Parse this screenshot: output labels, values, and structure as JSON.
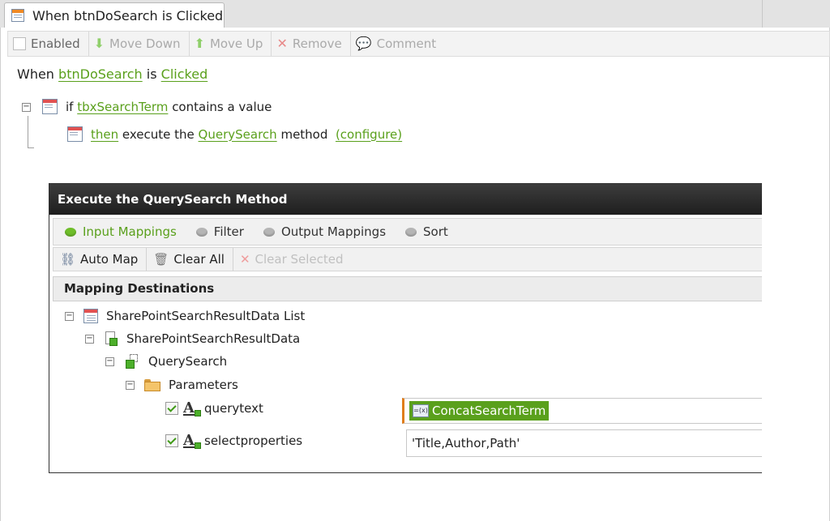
{
  "tab": {
    "title": "When btnDoSearch is Clicked"
  },
  "toolbar": {
    "enabled": "Enabled",
    "move_down": "Move Down",
    "move_up": "Move Up",
    "remove": "Remove",
    "comment": "Comment"
  },
  "rule": {
    "when": "When",
    "control": "btnDoSearch",
    "is": "is",
    "event": "Clicked",
    "condition": {
      "if": "if",
      "control": "tbxSearchTerm",
      "text": "contains a value"
    },
    "action": {
      "then": "then",
      "text": "execute the",
      "method": "QuerySearch",
      "suffix": "method",
      "configure": "(configure)"
    }
  },
  "dialog": {
    "title": "Execute the QuerySearch Method",
    "tabs": [
      {
        "label": "Input Mappings",
        "active": true
      },
      {
        "label": "Filter",
        "active": false
      },
      {
        "label": "Output Mappings",
        "active": false
      },
      {
        "label": "Sort",
        "active": false
      }
    ],
    "toolbar": {
      "auto_map": "Auto Map",
      "clear_all": "Clear All",
      "clear_selected": "Clear Selected"
    },
    "section_title": "Mapping Destinations",
    "tree": {
      "list": "SharePointSearchResultData List",
      "object": "SharePointSearchResultData",
      "method": "QuerySearch",
      "parameters": "Parameters",
      "params": [
        {
          "name": "querytext",
          "value": "ConcatSearchTerm",
          "value_is_token": true
        },
        {
          "name": "selectproperties",
          "value": "'Title,Author,Path'",
          "value_is_token": false
        }
      ]
    }
  },
  "colors": {
    "link_green": "#5aa01c",
    "token_green": "#5aa01c",
    "title_bar": "#2a2a2a"
  }
}
